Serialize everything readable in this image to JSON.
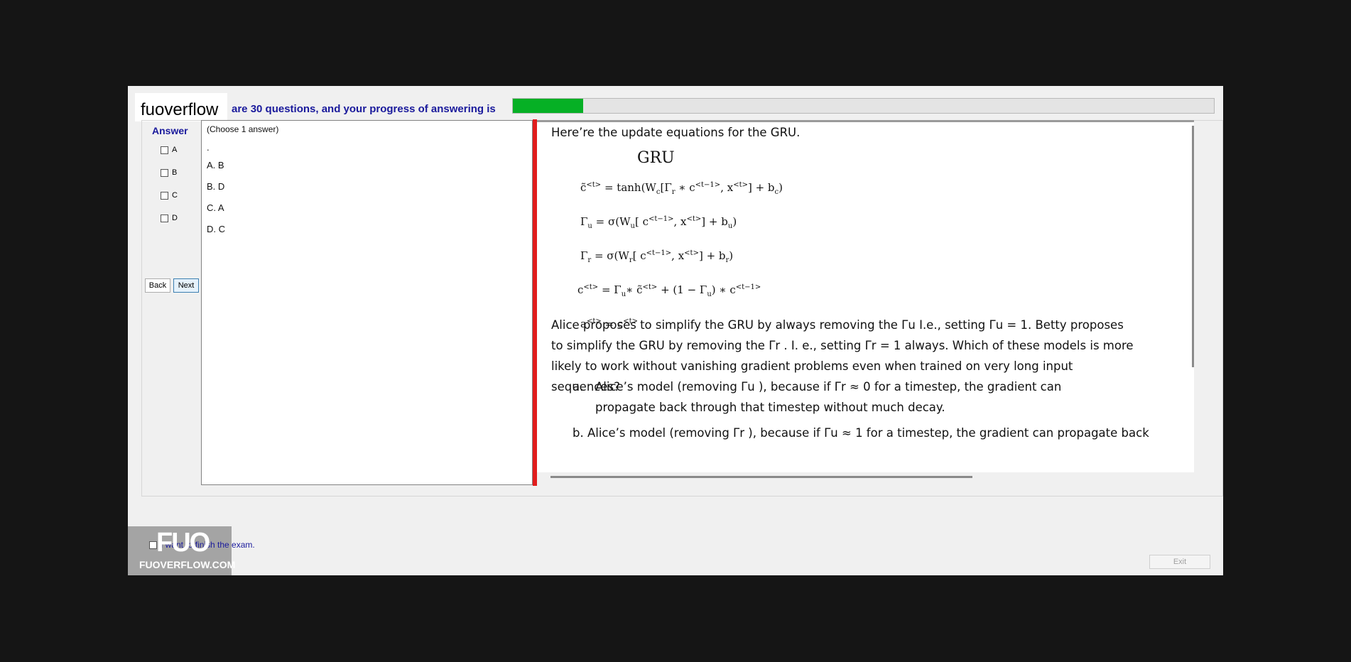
{
  "header": {
    "logo": "fuoverflow",
    "progress_text": "are 30 questions, and your progress of answering is",
    "progress_fraction": 0.1
  },
  "answer": {
    "label": "Answer",
    "options": [
      "A",
      "B",
      "C",
      "D"
    ]
  },
  "nav": {
    "back": "Back",
    "next": "Next"
  },
  "choices": {
    "instruction": "(Choose 1 answer)",
    "dot": ".",
    "items": [
      "A. B",
      "B. D",
      "C. A",
      "D. C"
    ]
  },
  "question": {
    "intro": "Here’re the update equations for the GRU.",
    "gru_title": "GRU",
    "paragraph": "Alice proposes to simplify the GRU by always removing the Γu I.e., setting Γu = 1. Betty proposes to simplify the GRU by removing the Γr . I. e., setting Γr = 1 always. Which of these models is more likely to work without vanishing gradient problems even when trained on very long input sequences?",
    "option_a_marker": "a.",
    "option_a": "Alice’s model (removing Γu ), because if Γr ≈ 0 for a timestep, the gradient can propagate back through that timestep without much decay.",
    "option_b_partial": "b.   Alice’s model (removing Γr ), because if Γu ≈ 1 for a timestep, the gradient can propagate back"
  },
  "footer": {
    "finish_text": "I want to finish the exam.",
    "exit": "Exit"
  },
  "watermark": {
    "brand": "FUO",
    "site": "FUOVERFLOW.COM"
  },
  "colors": {
    "progress": "#06b025",
    "accent_text": "#1a1a9c",
    "divider": "#e11d1d"
  }
}
